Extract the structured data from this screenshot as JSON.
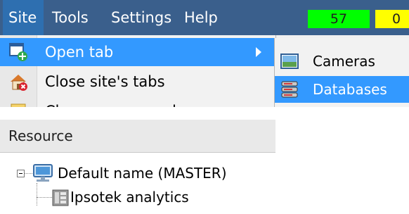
{
  "menubar": {
    "items": [
      {
        "label": "Site"
      },
      {
        "label": "Tools"
      },
      {
        "label": "Settings"
      },
      {
        "label": "Help"
      }
    ],
    "counters": [
      {
        "value": "57",
        "color": "#00ff00"
      },
      {
        "value": "0",
        "color": "#ffff00"
      }
    ]
  },
  "site_menu": {
    "items": [
      {
        "label": "Open tab",
        "icon": "open-tab-icon"
      },
      {
        "label": "Close site's tabs",
        "icon": "close-site-tabs-icon"
      },
      {
        "label": "Change password",
        "icon": "change-password-icon"
      }
    ]
  },
  "open_tab_submenu": {
    "items": [
      {
        "label": "Cameras",
        "icon": "cameras-icon"
      },
      {
        "label": "Databases",
        "icon": "databases-icon"
      }
    ]
  },
  "resource_tree": {
    "header": "Resource",
    "nodes": [
      {
        "label": "Default name (MASTER)",
        "icon": "server-icon"
      },
      {
        "label": "Ipsotek analytics",
        "icon": "analytics-icon"
      }
    ]
  }
}
